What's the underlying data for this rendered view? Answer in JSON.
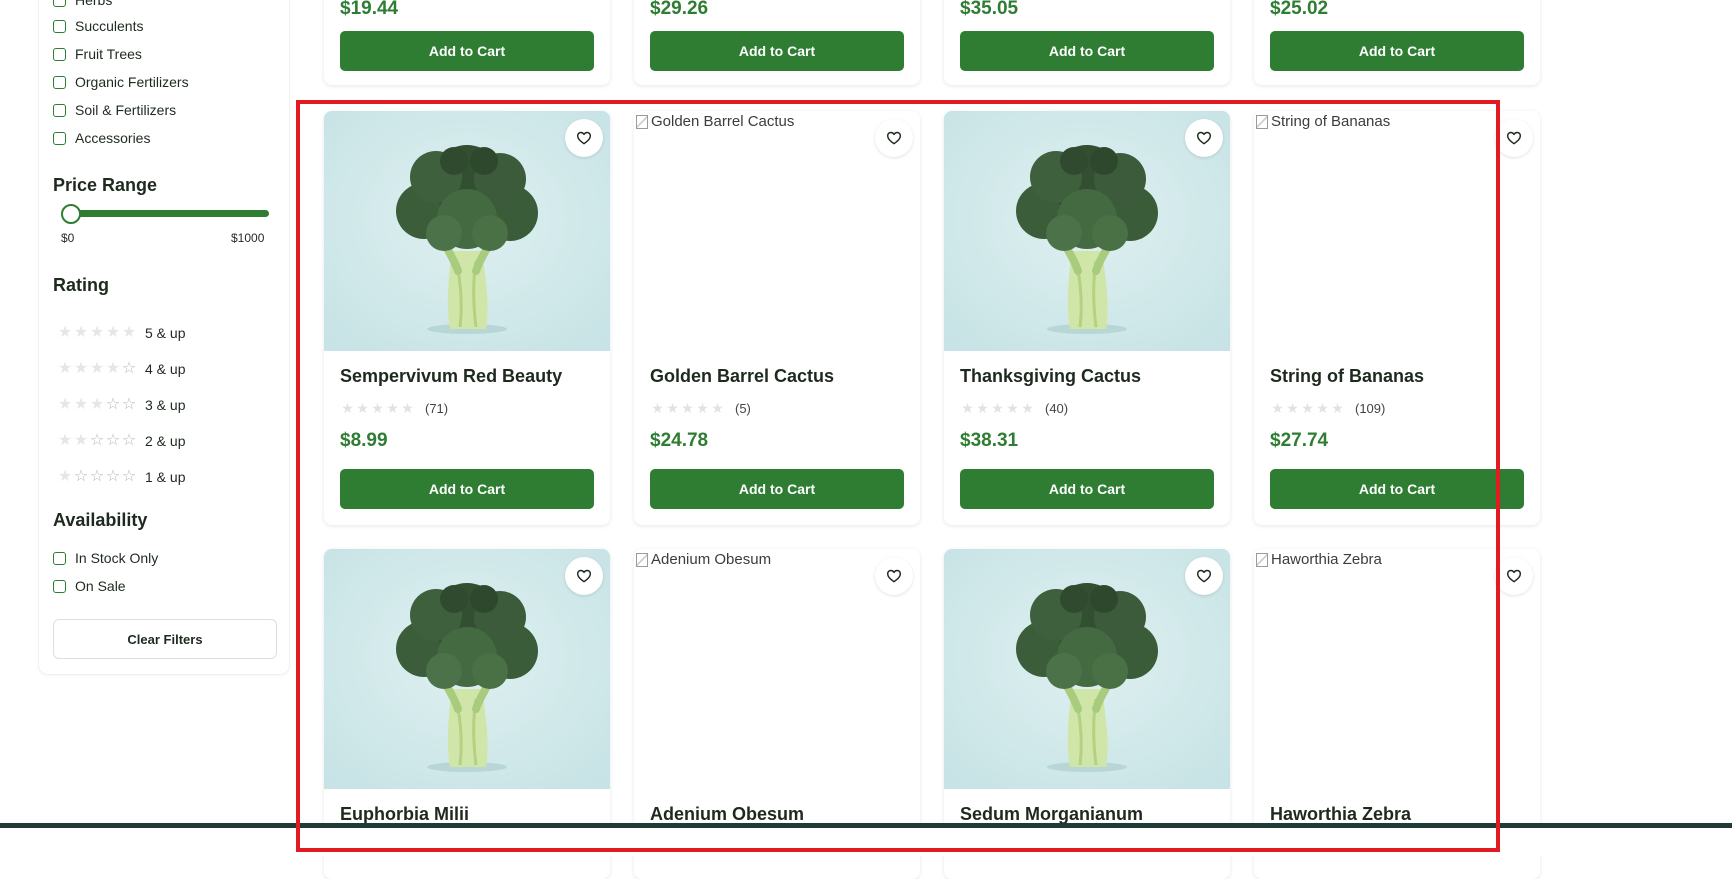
{
  "sidebar": {
    "categories": [
      {
        "label": "Herbs"
      },
      {
        "label": "Succulents"
      },
      {
        "label": "Fruit Trees"
      },
      {
        "label": "Organic Fertilizers"
      },
      {
        "label": "Soil & Fertilizers"
      },
      {
        "label": "Accessories"
      }
    ],
    "price_range": {
      "title": "Price Range",
      "min_label": "$0",
      "max_label": "$1000",
      "value": 0
    },
    "rating": {
      "title": "Rating",
      "options": [
        {
          "label": "5 & up",
          "stars": 5
        },
        {
          "label": "4 & up",
          "stars": 4
        },
        {
          "label": "3 & up",
          "stars": 3
        },
        {
          "label": "2 & up",
          "stars": 2
        },
        {
          "label": "1 & up",
          "stars": 1
        }
      ]
    },
    "availability": {
      "title": "Availability",
      "options": [
        {
          "label": "In Stock Only"
        },
        {
          "label": "On Sale"
        }
      ]
    },
    "clear_label": "Clear Filters"
  },
  "top_row": [
    {
      "price": "$19.44",
      "button": "Add to Cart"
    },
    {
      "price": "$29.26",
      "button": "Add to Cart"
    },
    {
      "price": "$35.05",
      "button": "Add to Cart"
    },
    {
      "price": "$25.02",
      "button": "Add to Cart"
    }
  ],
  "products": [
    {
      "name": "Sempervivum Red Beauty",
      "reviews": "(71)",
      "price": "$8.99",
      "button": "Add to Cart",
      "image": "broccoli-photo"
    },
    {
      "name": "Golden Barrel Cactus",
      "reviews": "(5)",
      "price": "$24.78",
      "button": "Add to Cart",
      "image": "broken",
      "alt": "Golden Barrel Cactus"
    },
    {
      "name": "Thanksgiving Cactus",
      "reviews": "(40)",
      "price": "$38.31",
      "button": "Add to Cart",
      "image": "broccoli-photo"
    },
    {
      "name": "String of Bananas",
      "reviews": "(109)",
      "price": "$27.74",
      "button": "Add to Cart",
      "image": "broken",
      "alt": "String of Bananas"
    },
    {
      "name": "Euphorbia Milii",
      "image": "broccoli-photo"
    },
    {
      "name": "Adenium Obesum",
      "image": "broken",
      "alt": "Adenium Obesum"
    },
    {
      "name": "Sedum Morganianum",
      "image": "broccoli-photo"
    },
    {
      "name": "Haworthia Zebra",
      "image": "broken",
      "alt": "Haworthia Zebra"
    }
  ],
  "colors": {
    "accent": "#2e7d32",
    "highlight": "#e21b23",
    "footer_bar": "#1e3b35"
  }
}
